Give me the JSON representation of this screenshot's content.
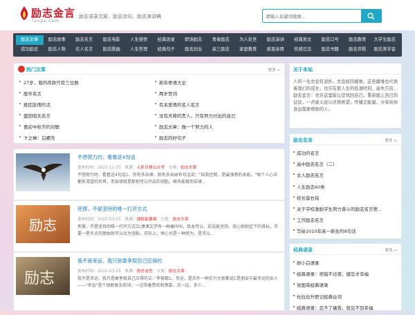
{
  "header": {
    "logo_title": "励志金言",
    "logo_sub": "lzvps.com",
    "slogan": "励志语录文案、励志诗句、励志演讲稿",
    "search_placeholder": "请输入关键词搜索..."
  },
  "nav": {
    "row1": [
      "励志文章",
      "励志故事",
      "励志名言",
      "励志电影",
      "人生感悟",
      "经典语录",
      "职场励志",
      "青春励志",
      "为人处世",
      "励志演讲",
      "经典美文",
      "励志口号",
      "励志教育",
      "大学生励志"
    ],
    "row2": [
      "成功励志",
      "励志人物",
      "名人名言",
      "励志歌曲",
      "人生哲理",
      "经典句子",
      "励志创业",
      "高三励志",
      "家庭教育",
      "感恩亲情",
      "伤感日志",
      "励志书籍",
      "励志评歌",
      "励志美学金"
    ]
  },
  "hot": {
    "title": "热门文章",
    "more": "更多 >",
    "left": [
      "27岁，我的存款只有三位数",
      "股市名言",
      "挽回友情的话",
      "盛田昭夫名言",
      "喜迎中秋节的对联",
      "卞之琳：白螺壳"
    ],
    "right": [
      "新年寄语大全",
      "两岁贺词",
      "有关爱情的名人名言",
      "没有天降的贵人，只有努力付出的自己",
      "励志文章：做一个努力的人",
      "励志的好句子"
    ]
  },
  "articles": [
    {
      "title": "不想努力时，看看这4句话",
      "date_label": "发布时间：2022-11-25",
      "source_label": "来源：",
      "source": "人民日报公众号",
      "cat_label": "分类：",
      "category": "励志文章",
      "desc": "不想努力时，看看这4句话1、你有多自律，就有多自由有句话说：\"自我控制，是最强者的本能。\"每个人心中都有渴望的世界，而自律就是那把可以开启的钥匙。唯有能做到自律..."
    },
    {
      "title": "死撑，不是坚持的唯一打开方式",
      "date_label": "发布时间：2022-03-25",
      "source_label": "来源：",
      "source": "搜狐能量阁",
      "cat_label": "分类：",
      "category": "励志文章",
      "desc": "死撑，不是坚持的唯一打开方式文/潇潇文学有一种痛叫叫，我本可以，却没能坚持。烧心勃勃定下的目标，只要一星半点的理由就可以化为泡影。实际上，恒心也是一种修为，是可以..."
    },
    {
      "title": "我不是幸运，我只是敢争取自己应得的",
      "date_label": "发布时间：2022-03-25",
      "source_label": "来源：",
      "source": "励志金言",
      "cat_label": "分类：",
      "category": "励志文章",
      "desc": "我不是幸运，我只是敢争取自己应得的文／李筱懿1、幸运，是另外一种实力大家都说C是朋友中最幸运的女人——\"幸运\"是个很耐复杂的词，一边带着赞叹和羡慕，另一边，多少..."
    }
  ],
  "about": {
    "title": "关于本站",
    "text": "人的一生总会有波折，总会经历磨难，这些磨难也代表着我们的成长，也许在那人生的低潮时刻，迷失方向...励志金言：也许这里能让您找回自己，重新踏上自己的征途，一点星火足以点燃希望，传播正能量，分享给你身边需要帮助的人。"
  },
  "quotes": {
    "title": "励志名言",
    "more": "更多 >",
    "items": [
      "成功的名言",
      "高中励志名言（二）",
      "女人励志名言",
      "人生励志60条",
      "校长座右铭",
      "关于学校激励学生努力奋斗的励志名言警...",
      "工作励志名言",
      "写给2010年高一新生的8句话"
    ]
  },
  "classic": {
    "title": "经典语录",
    "more": "更多 >",
    "items": [
      "顾小白语录",
      "经典语录：烦恼不过夜，健忘才幸福",
      "张国荣经典语录",
      "杜拉拉升职记经典台词",
      "经典语录：忍不了痛苦，就见不到幸福"
    ]
  }
}
